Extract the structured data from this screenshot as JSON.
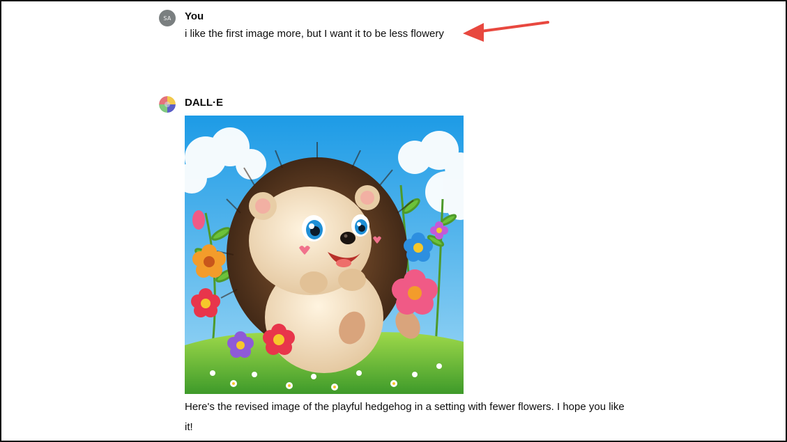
{
  "conversation": {
    "user_message": {
      "avatar_initials": "SA",
      "author": "You",
      "text": "i like the first image more, but I want it to be less flowery"
    },
    "assistant_message": {
      "author": "DALL·E",
      "image_label": "hedgehog-illustration",
      "text": "Here's the revised image of the playful hedgehog in a setting with fewer flowers. I hope you like it!"
    }
  },
  "colors": {
    "annotation_arrow": "#e8483f",
    "user_avatar_bg": "#7a7f80"
  }
}
